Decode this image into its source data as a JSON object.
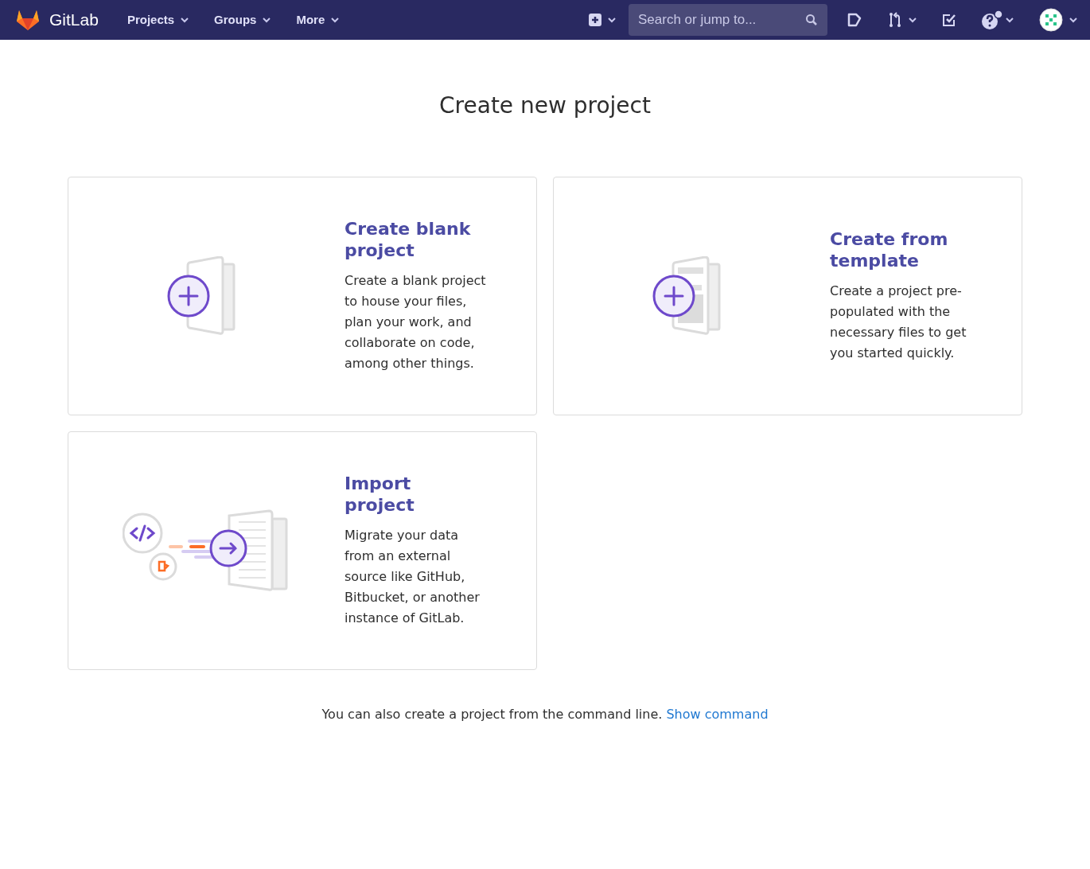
{
  "navbar": {
    "brand": "GitLab",
    "menus": [
      "Projects",
      "Groups",
      "More"
    ],
    "search": {
      "placeholder": "Search or jump to..."
    }
  },
  "title": "Create new project",
  "cards": [
    {
      "kind": "blank",
      "title": "Create blank project",
      "description": "Create a blank project to house your files, plan your work, and collaborate on code, among other things."
    },
    {
      "kind": "template",
      "title": "Create from template",
      "description": "Create a project pre-populated with the necessary files to get you started quickly."
    },
    {
      "kind": "import",
      "title": "Import project",
      "description": "Migrate your data from an external source like GitHub, Bitbucket, or another instance of GitLab."
    }
  ],
  "footer": {
    "text": "You can also create a project from the command line.",
    "link": "Show command"
  }
}
